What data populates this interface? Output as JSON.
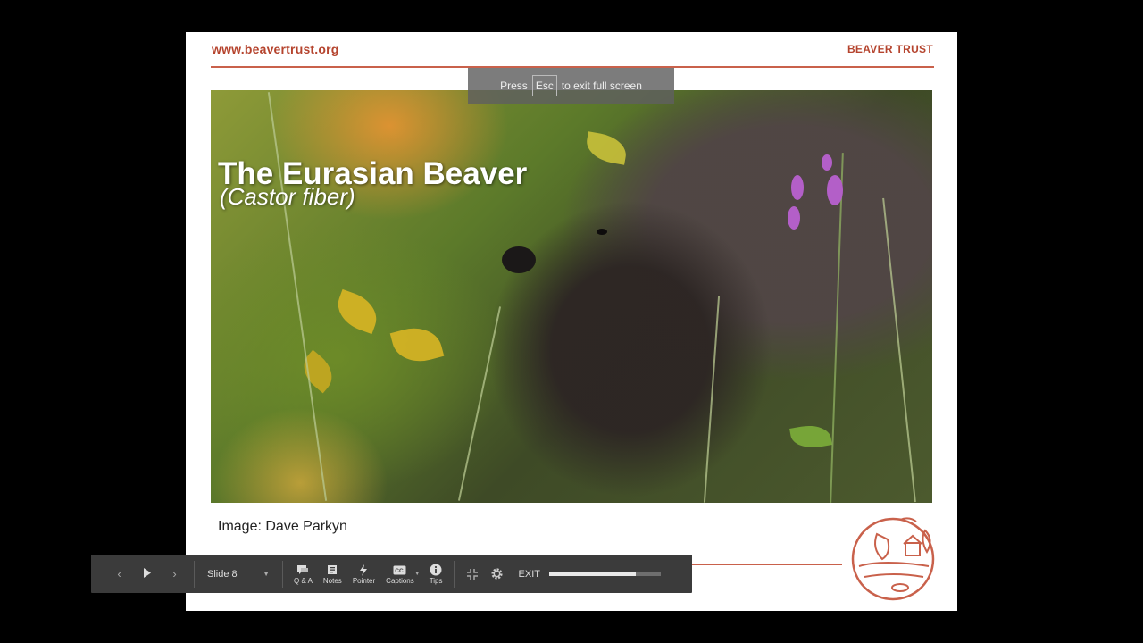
{
  "slide": {
    "site_url": "www.beavertrust.org",
    "brand": "BEAVER TRUST",
    "title": "The Eurasian Beaver",
    "subtitle": "(Castor fiber)",
    "credit": "Image: Dave Parkyn",
    "logo_icon": "beaver-trust-logo-icon"
  },
  "fullscreen_notice": {
    "press": "Press",
    "key": "Esc",
    "rest": "to exit full screen"
  },
  "toolbar": {
    "prev_icon": "chevron-left-icon",
    "play_icon": "play-icon",
    "next_icon": "chevron-right-icon",
    "slide_label": "Slide 8",
    "buttons": [
      {
        "label": "Q & A",
        "icon": "qa-icon"
      },
      {
        "label": "Notes",
        "icon": "notes-icon"
      },
      {
        "label": "Pointer",
        "icon": "pointer-icon"
      },
      {
        "label": "Captions",
        "icon": "captions-icon"
      },
      {
        "label": "Tips",
        "icon": "info-icon"
      }
    ],
    "exit_fullscreen_icon": "exit-fullscreen-icon",
    "settings_icon": "gear-icon",
    "exit_label": "EXIT",
    "progress": 0.78
  },
  "colors": {
    "brand_red": "#b5442e",
    "toolbar_bg": "#3b3b3b"
  }
}
